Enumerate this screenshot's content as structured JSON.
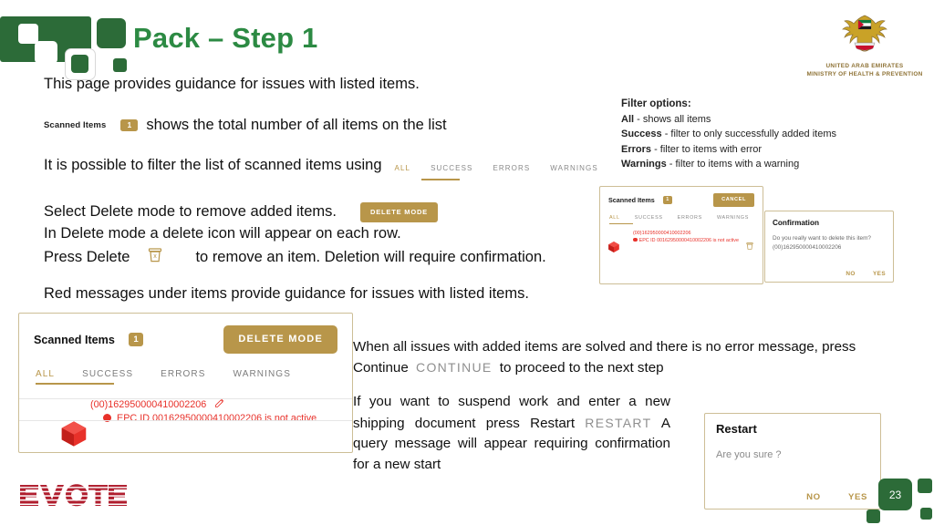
{
  "title": "Pack – Step 1",
  "emblem": {
    "line1": "UNITED ARAB EMIRATES",
    "line2": "MINISTRY OF HEALTH & PREVENTION"
  },
  "paragraphs": {
    "intro": "This page provides guidance for issues with listed items.",
    "scanned_items_label": "Scanned Items",
    "scanned_items_count": "1",
    "scanned_items_rest": "shows the total number of all items on the list",
    "filter_intro": "It is possible to filter the list of scanned items using",
    "delete_line1": "Select Delete mode to remove added items.",
    "delete_mode_button": "DELETE MODE",
    "delete_line2": "In Delete mode a delete icon will appear on each row.",
    "delete_line3a": "Press Delete",
    "delete_line3b": "to remove an item. Deletion will require confirmation.",
    "red_messages": "Red messages under items provide guidance for issues with listed items.",
    "continue_a": "When all issues with added items are solved and there is no error message, press Continue",
    "continue_ghost": "CONTINUE",
    "continue_b": "to proceed to the next step",
    "restart_a": "If you want to suspend work and enter a new shipping document press Restart",
    "restart_ghost": "RESTART",
    "restart_b": "A query message will appear requiring confirmation for a new start"
  },
  "inline_tabs": [
    "ALL",
    "SUCCESS",
    "ERRORS",
    "WARNINGS"
  ],
  "filter_options": {
    "heading": "Filter options:",
    "items": [
      {
        "name": "All",
        "desc": " - shows all items"
      },
      {
        "name": "Success",
        "desc": " - filter to only successfully added items"
      },
      {
        "name": "Errors",
        "desc": " - filter to items with error"
      },
      {
        "name": "Warnings",
        "desc": " - filter to items with a warning"
      }
    ]
  },
  "mini_panel": {
    "title": "Scanned Items",
    "badge": "1",
    "cancel": "CANCEL",
    "tabs": [
      "ALL",
      "SUCCESS",
      "ERRORS",
      "WARNINGS"
    ],
    "item_code": "(00)162950000410002206",
    "item_error": "EPC ID 00162950000410002206 is not active"
  },
  "confirmation": {
    "title": "Confirmation",
    "body": "Do you really want to delete this item? (00)162950000410002206",
    "no": "NO",
    "yes": "YES"
  },
  "big_panel": {
    "title": "Scanned Items",
    "badge": "1",
    "delete_mode": "DELETE MODE",
    "tabs": [
      "ALL",
      "SUCCESS",
      "ERRORS",
      "WARNINGS"
    ],
    "item_code": "(00)162950000410002206",
    "item_error": "EPC ID 00162950000410002206 is not active"
  },
  "restart_dialog": {
    "title": "Restart",
    "body": "Are you sure ?",
    "no": "NO",
    "yes": "YES"
  },
  "footer": {
    "logo": "EVOTEQ",
    "page_number": "23"
  },
  "colors": {
    "green": "#2c6b38",
    "title_green": "#2c8a43",
    "gold": "#b8964a",
    "red": "#e8312a",
    "emblem_gold": "#8e7235",
    "logo_red": "#b01e2e"
  }
}
